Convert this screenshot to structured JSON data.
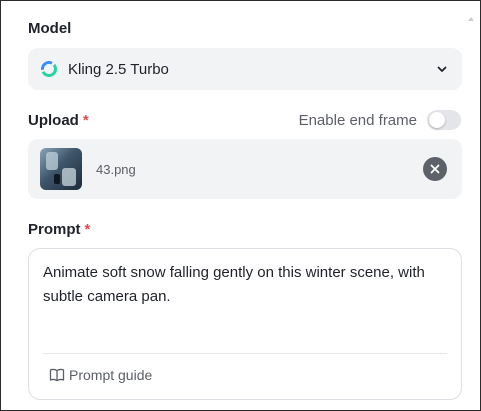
{
  "model": {
    "label": "Model",
    "selected": "Kling 2.5 Turbo",
    "logo_icon": "kling-logo-icon",
    "dropdown_icon": "chevron-down-icon"
  },
  "upload": {
    "label": "Upload",
    "required_mark": "*",
    "end_frame_label": "Enable end frame",
    "end_frame_enabled": false,
    "file_name": "43.png",
    "remove_icon": "close-icon"
  },
  "prompt": {
    "label": "Prompt",
    "required_mark": "*",
    "value": "Animate soft snow falling gently on this winter scene, with subtle camera pan.",
    "guide_label": "Prompt guide",
    "guide_icon": "book-icon"
  },
  "colors": {
    "required": "#e5484d",
    "field_bg": "#f2f3f5",
    "remove_button": "#5d6169"
  }
}
